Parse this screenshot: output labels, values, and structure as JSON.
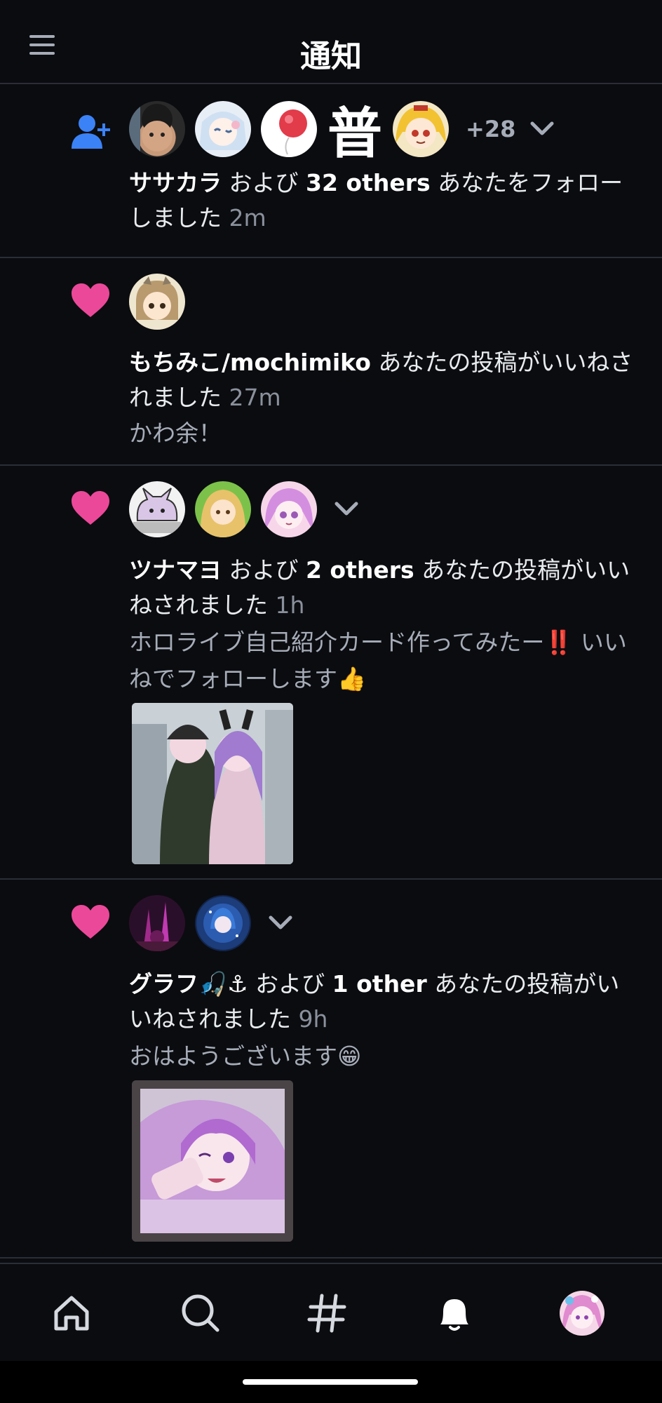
{
  "header": {
    "title": "通知"
  },
  "notifications": [
    {
      "type": "follow",
      "extra_count": "+28",
      "actor": "ササカラ",
      "joiner": " および ",
      "others": "32 others",
      "message": " あなたをフォローしました ",
      "time": "2m",
      "avatar_glyph": "普"
    },
    {
      "type": "like",
      "actor": "もちみこ/mochimiko",
      "message": " あなたの投稿がいいねされました ",
      "time": "27m",
      "snippet": "かわ余！"
    },
    {
      "type": "like",
      "actor": "ツナマヨ",
      "joiner": " および ",
      "others": "2 others",
      "message": " あなたの投稿がいいねされました ",
      "time": "1h",
      "snippet": "ホロライブ自己紹介カード作ってみたー‼️ いいねでフォローします👍"
    },
    {
      "type": "like",
      "actor": "グラフ🎣⚓",
      "joiner": " および ",
      "others": "1 other",
      "message": " あなたの投稿がいいねされました ",
      "time": "9h",
      "snippet": "おはようございます😁"
    }
  ],
  "colors": {
    "accent_blue": "#3b82f6",
    "like_pink": "#ec4899",
    "background": "#0b0c10",
    "divider": "#2b2e36"
  },
  "icons": {
    "menu": "hamburger-icon",
    "follow": "person-add-icon",
    "like": "heart-icon",
    "expand": "chevron-down-icon",
    "tabs": [
      "home-icon",
      "search-icon",
      "hashtag-icon",
      "bell-icon",
      "profile-avatar"
    ]
  }
}
